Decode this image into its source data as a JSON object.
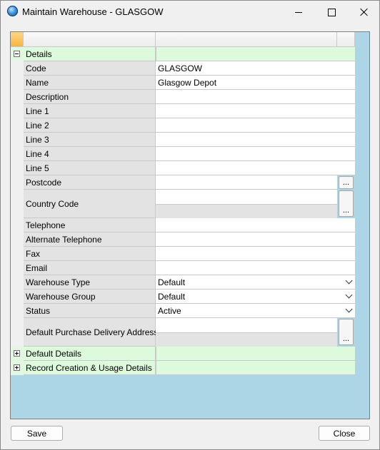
{
  "window": {
    "title": "Maintain Warehouse - GLASGOW"
  },
  "grid": {
    "details_group": "Details",
    "fields": {
      "code": {
        "label": "Code",
        "value": "GLASGOW"
      },
      "name": {
        "label": "Name",
        "value": "Glasgow Depot"
      },
      "description": {
        "label": "Description",
        "value": ""
      },
      "line1": {
        "label": "Line 1",
        "value": ""
      },
      "line2": {
        "label": "Line 2",
        "value": ""
      },
      "line3": {
        "label": "Line 3",
        "value": ""
      },
      "line4": {
        "label": "Line 4",
        "value": ""
      },
      "line5": {
        "label": "Line 5",
        "value": ""
      },
      "postcode": {
        "label": "Postcode",
        "value": ""
      },
      "country_code": {
        "label": "Country Code",
        "value": ""
      },
      "telephone": {
        "label": "Telephone",
        "value": ""
      },
      "alternate_telephone": {
        "label": "Alternate Telephone",
        "value": ""
      },
      "fax": {
        "label": "Fax",
        "value": ""
      },
      "email": {
        "label": "Email",
        "value": ""
      },
      "warehouse_type": {
        "label": "Warehouse Type",
        "value": "Default"
      },
      "warehouse_group": {
        "label": "Warehouse Group",
        "value": "Default"
      },
      "status": {
        "label": "Status",
        "value": "Active"
      },
      "default_purchase_delivery_address": {
        "label": "Default Purchase Delivery Address",
        "value": ""
      }
    },
    "ellipsis_label": "...",
    "default_details_group": "Default Details",
    "record_creation_group": "Record Creation & Usage Details"
  },
  "buttons": {
    "save": "Save",
    "close": "Close"
  },
  "icons": {
    "app": "app-globe-icon",
    "minimize": "minimize-icon",
    "maximize": "maximize-icon",
    "close": "close-icon",
    "collapse": "collapse-icon",
    "expand": "expand-icon",
    "dropdown": "chevron-down-icon"
  },
  "colors": {
    "panel_background": "#acd6e5",
    "group_row": "#ddfadd",
    "label_cell": "#e3e3e3",
    "header_corner": "#f7b43c"
  }
}
